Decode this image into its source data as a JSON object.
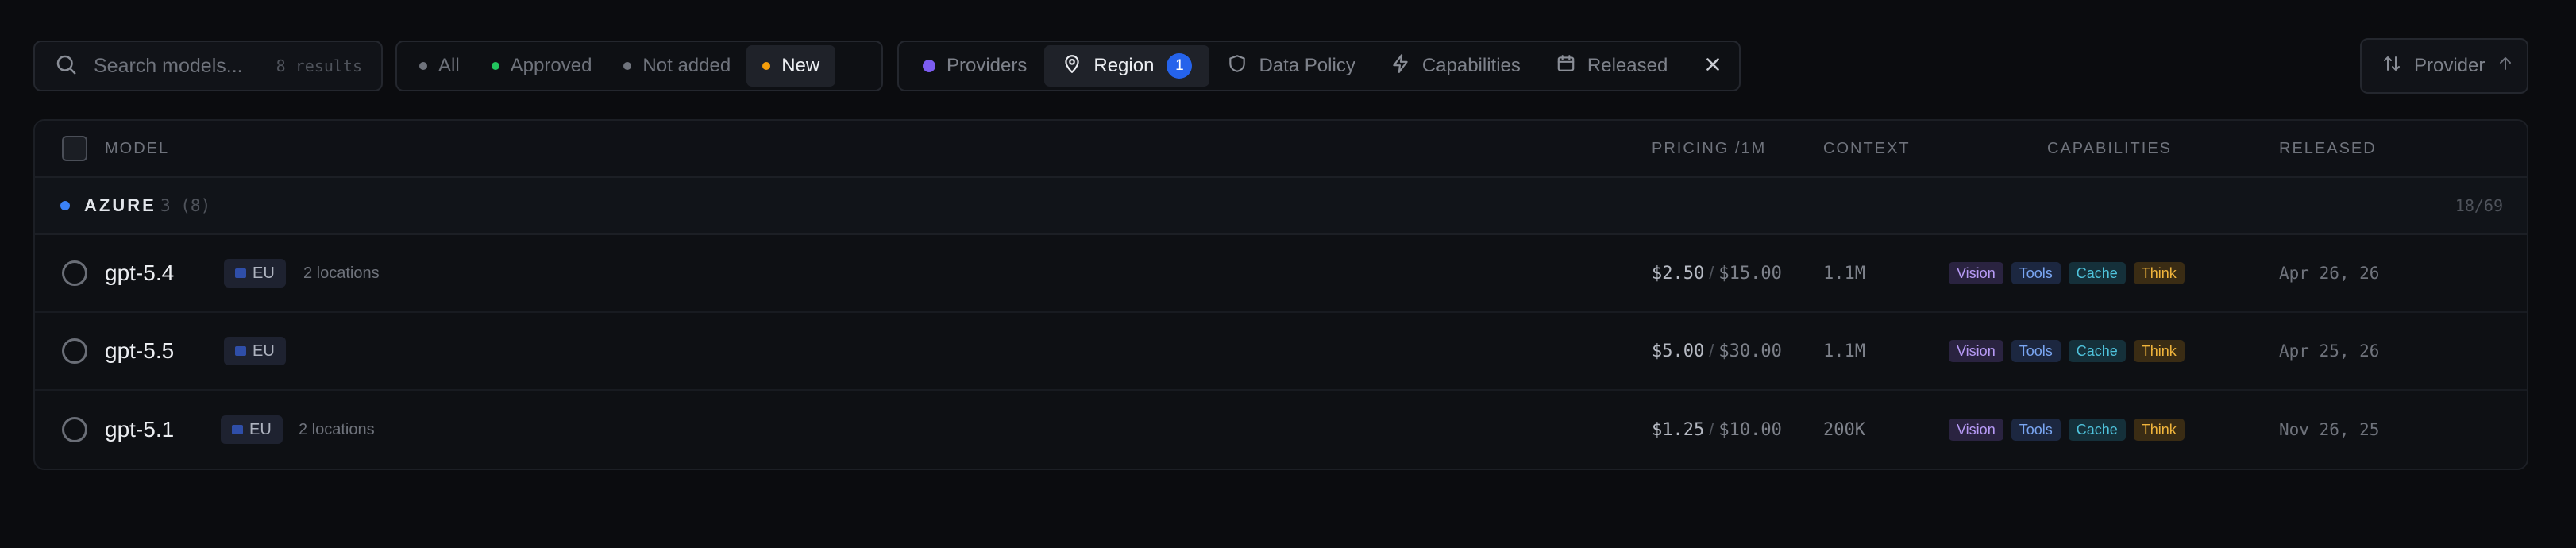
{
  "search": {
    "placeholder": "Search models...",
    "results": "8 results"
  },
  "status_filter": {
    "options": [
      {
        "label": "All",
        "dot": "#6f737c",
        "active": false
      },
      {
        "label": "Approved",
        "dot": "#22c55e",
        "active": false
      },
      {
        "label": "Not added",
        "dot": "#6f737c",
        "active": false
      },
      {
        "label": "New",
        "dot": "#f59e0b",
        "active": true
      }
    ]
  },
  "filters": {
    "providers_label": "Providers",
    "region_label": "Region",
    "region_count": "1",
    "data_policy_label": "Data Policy",
    "capabilities_label": "Capabilities",
    "released_label": "Released"
  },
  "sort": {
    "label": "Provider"
  },
  "table": {
    "headers": {
      "model": "Model",
      "pricing": "Pricing /1M",
      "context": "Context",
      "capabilities": "Capabilities",
      "released": "Released"
    },
    "group": {
      "name": "AZURE",
      "count": "3 (8)",
      "page": "18/69"
    },
    "rows": [
      {
        "model": "gpt-5.4",
        "region": "EU",
        "locations": "2 locations",
        "price_in": "$2.50",
        "price_sep": "/",
        "price_out": "$15.00",
        "context": "1.1M",
        "caps": [
          "Vision",
          "Tools",
          "Cache",
          "Think"
        ],
        "released": "Apr 26, 26"
      },
      {
        "model": "gpt-5.5",
        "region": "EU",
        "locations": "",
        "price_in": "$5.00",
        "price_sep": "/",
        "price_out": "$30.00",
        "context": "1.1M",
        "caps": [
          "Vision",
          "Tools",
          "Cache",
          "Think"
        ],
        "released": "Apr 25, 26"
      },
      {
        "model": "gpt-5.1",
        "region": "EU",
        "locations": "2 locations",
        "price_in": "$1.25",
        "price_sep": "/",
        "price_out": "$10.00",
        "context": "200K",
        "caps": [
          "Vision",
          "Tools",
          "Cache",
          "Think"
        ],
        "released": "Nov 26, 25"
      }
    ]
  },
  "colors": {
    "background": "#0b0c0f",
    "accent_blue": "#2563eb",
    "cap_vision_bg": "#2a2340",
    "cap_vision_fg": "#b79af5",
    "cap_tools_bg": "#1c2740",
    "cap_tools_fg": "#7aa6f2",
    "cap_cache_bg": "#15303a",
    "cap_cache_fg": "#4fc3dc",
    "cap_think_bg": "#3a2c14",
    "cap_think_fg": "#f0b43c"
  },
  "icons": {
    "search": "search-icon",
    "region": "map-pin-icon",
    "data_policy": "shield-icon",
    "capabilities": "lightning-icon",
    "released": "calendar-icon",
    "clear": "close-icon",
    "sort": "sort-arrows-icon",
    "sort_dir": "arrow-up-icon"
  }
}
